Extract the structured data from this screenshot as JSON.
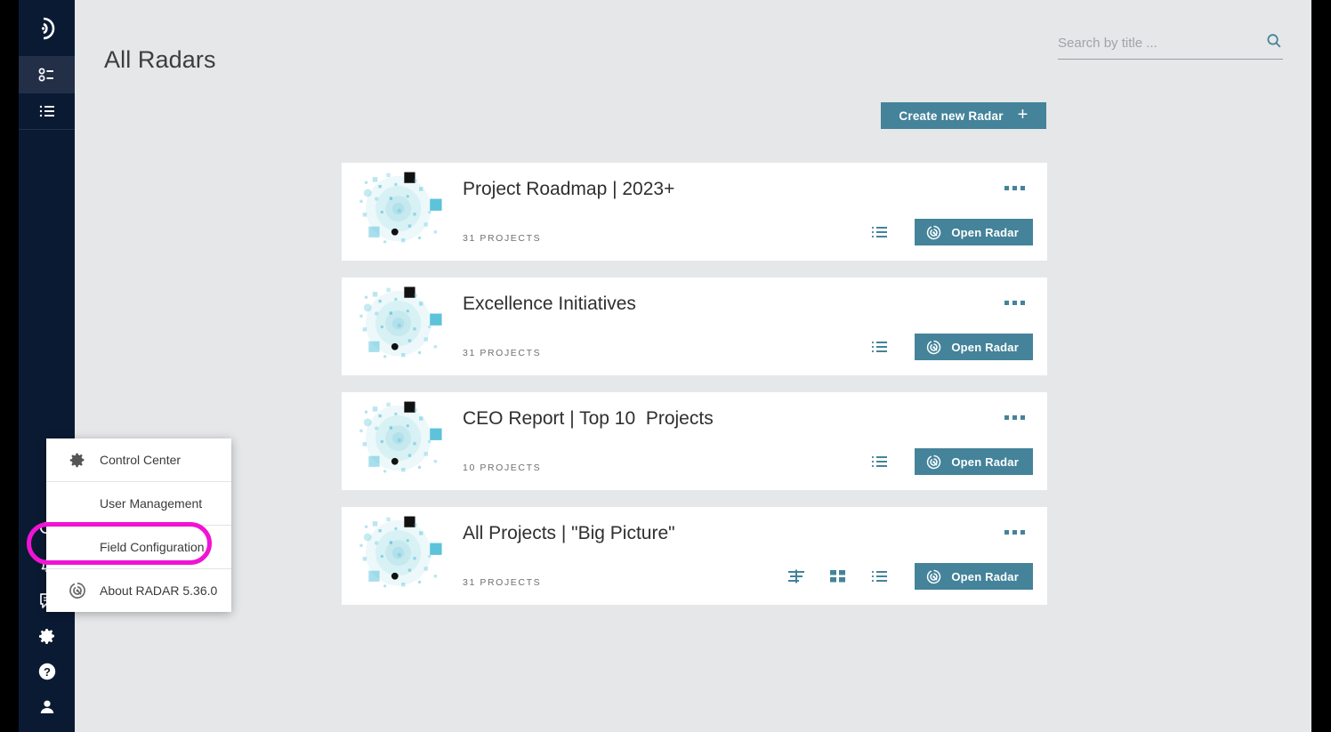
{
  "app": {
    "accent_teal": "#44839a",
    "sidebar_navy": "#0b1a33",
    "sidebar_selected": "#232e47",
    "page_background": "#e6e7e9",
    "highlight_color": "#f013d4"
  },
  "header": {
    "title": "All Radars"
  },
  "search": {
    "placeholder": "Search by title ...",
    "value": "",
    "icon": "search-icon"
  },
  "toolbar": {
    "create_label": "Create new Radar",
    "create_icon": "plus-icon"
  },
  "sidebar": {
    "top_items": [
      {
        "name": "radar-logo",
        "icon": "radar-logo-icon",
        "selected": false
      },
      {
        "name": "sidebar-item-radars",
        "icon": "radar-list-icon",
        "selected": true
      },
      {
        "name": "sidebar-item-list",
        "icon": "list-icon",
        "selected": false
      }
    ],
    "bottom_items": [
      {
        "name": "sidebar-item-search",
        "icon": "search-icon"
      },
      {
        "name": "sidebar-item-notifications",
        "icon": "bell-icon"
      },
      {
        "name": "sidebar-item-feedback",
        "icon": "comment-icon"
      },
      {
        "name": "sidebar-item-settings",
        "icon": "gear-icon"
      },
      {
        "name": "sidebar-item-help",
        "icon": "question-icon"
      },
      {
        "name": "sidebar-item-account",
        "icon": "person-icon"
      }
    ]
  },
  "popup_menu": {
    "items": [
      {
        "label": "Control Center",
        "icon": "gear-icon",
        "highlighted": false
      },
      {
        "label": "User Management",
        "icon": "",
        "highlighted": false
      },
      {
        "label": "Field Configuration",
        "icon": "",
        "highlighted": true
      },
      {
        "label": "About RADAR 5.36.0",
        "icon": "radar-icon",
        "highlighted": false
      }
    ]
  },
  "cards": [
    {
      "title": "Project Roadmap | 2023+",
      "count": "31 PROJECTS",
      "actions": [
        "list-icon"
      ],
      "open_label": "Open Radar",
      "open_icon": "radar-icon",
      "menu_icon": "more-options-icon"
    },
    {
      "title": "Excellence Initiatives",
      "count": "31 PROJECTS",
      "actions": [
        "list-icon"
      ],
      "open_label": "Open Radar",
      "open_icon": "radar-icon",
      "menu_icon": "more-options-icon"
    },
    {
      "title": "CEO Report | Top 10  Projects",
      "count": "10 PROJECTS",
      "actions": [
        "list-icon"
      ],
      "open_label": "Open Radar",
      "open_icon": "radar-icon",
      "menu_icon": "more-options-icon"
    },
    {
      "title": "All Projects | \"Big Picture\"",
      "count": "31 PROJECTS",
      "actions": [
        "chart-bars-icon",
        "grid-icon",
        "list-icon"
      ],
      "open_label": "Open Radar",
      "open_icon": "radar-icon",
      "menu_icon": "more-options-icon"
    }
  ]
}
